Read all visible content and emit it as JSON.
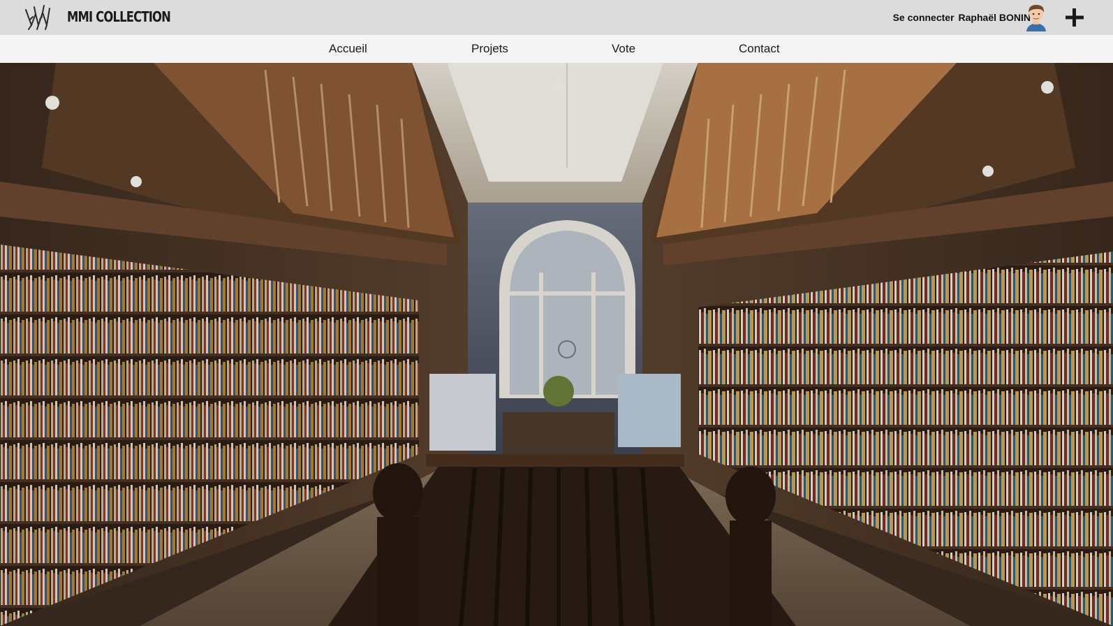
{
  "header": {
    "brand": "MMI COLLECTION",
    "logo_icon": "crown-logo-icon",
    "login_label": "Se connecter",
    "user_name": "Raphaël BONIN",
    "avatar_icon": "user-avatar-icon",
    "add_icon": "plus-icon"
  },
  "nav": {
    "items": [
      {
        "label": "Accueil"
      },
      {
        "label": "Projets"
      },
      {
        "label": "Vote"
      },
      {
        "label": "Contact"
      }
    ]
  },
  "hero": {
    "image": "library-bookstore-interior-photo"
  },
  "colors": {
    "topbar": "#dcdcdc",
    "navbar": "#f4f4f4",
    "text": "#1a1a1a"
  }
}
